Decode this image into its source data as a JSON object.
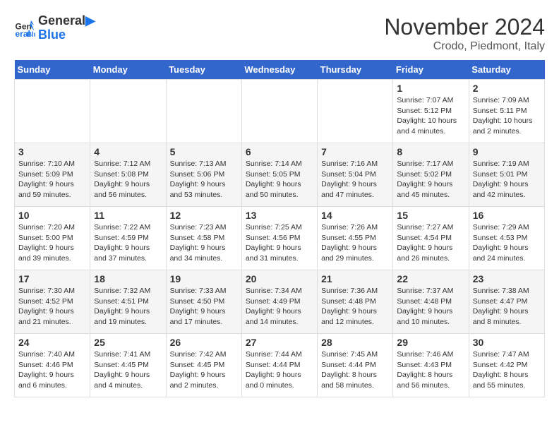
{
  "header": {
    "logo": {
      "line1": "General",
      "line2": "Blue"
    },
    "title": "November 2024",
    "location": "Crodo, Piedmont, Italy"
  },
  "days_of_week": [
    "Sunday",
    "Monday",
    "Tuesday",
    "Wednesday",
    "Thursday",
    "Friday",
    "Saturday"
  ],
  "weeks": [
    [
      {
        "day": "",
        "info": ""
      },
      {
        "day": "",
        "info": ""
      },
      {
        "day": "",
        "info": ""
      },
      {
        "day": "",
        "info": ""
      },
      {
        "day": "",
        "info": ""
      },
      {
        "day": "1",
        "info": "Sunrise: 7:07 AM\nSunset: 5:12 PM\nDaylight: 10 hours\nand 4 minutes."
      },
      {
        "day": "2",
        "info": "Sunrise: 7:09 AM\nSunset: 5:11 PM\nDaylight: 10 hours\nand 2 minutes."
      }
    ],
    [
      {
        "day": "3",
        "info": "Sunrise: 7:10 AM\nSunset: 5:09 PM\nDaylight: 9 hours\nand 59 minutes."
      },
      {
        "day": "4",
        "info": "Sunrise: 7:12 AM\nSunset: 5:08 PM\nDaylight: 9 hours\nand 56 minutes."
      },
      {
        "day": "5",
        "info": "Sunrise: 7:13 AM\nSunset: 5:06 PM\nDaylight: 9 hours\nand 53 minutes."
      },
      {
        "day": "6",
        "info": "Sunrise: 7:14 AM\nSunset: 5:05 PM\nDaylight: 9 hours\nand 50 minutes."
      },
      {
        "day": "7",
        "info": "Sunrise: 7:16 AM\nSunset: 5:04 PM\nDaylight: 9 hours\nand 47 minutes."
      },
      {
        "day": "8",
        "info": "Sunrise: 7:17 AM\nSunset: 5:02 PM\nDaylight: 9 hours\nand 45 minutes."
      },
      {
        "day": "9",
        "info": "Sunrise: 7:19 AM\nSunset: 5:01 PM\nDaylight: 9 hours\nand 42 minutes."
      }
    ],
    [
      {
        "day": "10",
        "info": "Sunrise: 7:20 AM\nSunset: 5:00 PM\nDaylight: 9 hours\nand 39 minutes."
      },
      {
        "day": "11",
        "info": "Sunrise: 7:22 AM\nSunset: 4:59 PM\nDaylight: 9 hours\nand 37 minutes."
      },
      {
        "day": "12",
        "info": "Sunrise: 7:23 AM\nSunset: 4:58 PM\nDaylight: 9 hours\nand 34 minutes."
      },
      {
        "day": "13",
        "info": "Sunrise: 7:25 AM\nSunset: 4:56 PM\nDaylight: 9 hours\nand 31 minutes."
      },
      {
        "day": "14",
        "info": "Sunrise: 7:26 AM\nSunset: 4:55 PM\nDaylight: 9 hours\nand 29 minutes."
      },
      {
        "day": "15",
        "info": "Sunrise: 7:27 AM\nSunset: 4:54 PM\nDaylight: 9 hours\nand 26 minutes."
      },
      {
        "day": "16",
        "info": "Sunrise: 7:29 AM\nSunset: 4:53 PM\nDaylight: 9 hours\nand 24 minutes."
      }
    ],
    [
      {
        "day": "17",
        "info": "Sunrise: 7:30 AM\nSunset: 4:52 PM\nDaylight: 9 hours\nand 21 minutes."
      },
      {
        "day": "18",
        "info": "Sunrise: 7:32 AM\nSunset: 4:51 PM\nDaylight: 9 hours\nand 19 minutes."
      },
      {
        "day": "19",
        "info": "Sunrise: 7:33 AM\nSunset: 4:50 PM\nDaylight: 9 hours\nand 17 minutes."
      },
      {
        "day": "20",
        "info": "Sunrise: 7:34 AM\nSunset: 4:49 PM\nDaylight: 9 hours\nand 14 minutes."
      },
      {
        "day": "21",
        "info": "Sunrise: 7:36 AM\nSunset: 4:48 PM\nDaylight: 9 hours\nand 12 minutes."
      },
      {
        "day": "22",
        "info": "Sunrise: 7:37 AM\nSunset: 4:48 PM\nDaylight: 9 hours\nand 10 minutes."
      },
      {
        "day": "23",
        "info": "Sunrise: 7:38 AM\nSunset: 4:47 PM\nDaylight: 9 hours\nand 8 minutes."
      }
    ],
    [
      {
        "day": "24",
        "info": "Sunrise: 7:40 AM\nSunset: 4:46 PM\nDaylight: 9 hours\nand 6 minutes."
      },
      {
        "day": "25",
        "info": "Sunrise: 7:41 AM\nSunset: 4:45 PM\nDaylight: 9 hours\nand 4 minutes."
      },
      {
        "day": "26",
        "info": "Sunrise: 7:42 AM\nSunset: 4:45 PM\nDaylight: 9 hours\nand 2 minutes."
      },
      {
        "day": "27",
        "info": "Sunrise: 7:44 AM\nSunset: 4:44 PM\nDaylight: 9 hours\nand 0 minutes."
      },
      {
        "day": "28",
        "info": "Sunrise: 7:45 AM\nSunset: 4:44 PM\nDaylight: 8 hours\nand 58 minutes."
      },
      {
        "day": "29",
        "info": "Sunrise: 7:46 AM\nSunset: 4:43 PM\nDaylight: 8 hours\nand 56 minutes."
      },
      {
        "day": "30",
        "info": "Sunrise: 7:47 AM\nSunset: 4:42 PM\nDaylight: 8 hours\nand 55 minutes."
      }
    ]
  ]
}
